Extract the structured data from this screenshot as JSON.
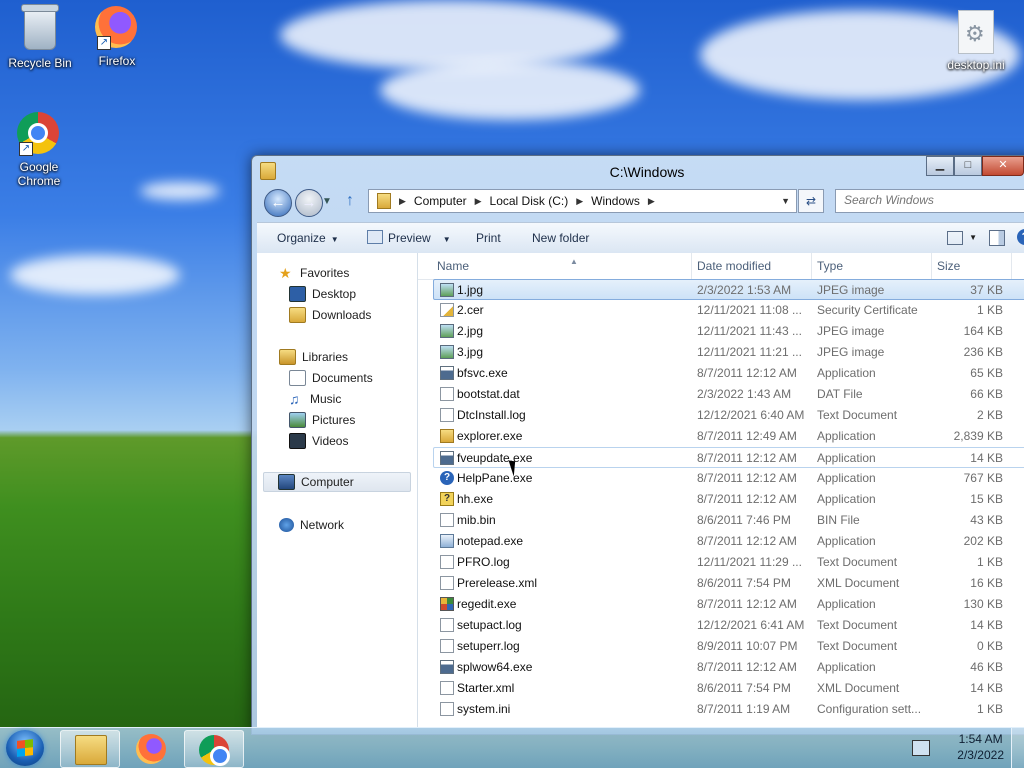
{
  "desktop": {
    "icons": [
      {
        "label": "Recycle Bin"
      },
      {
        "label": "Firefox"
      },
      {
        "label": "Google Chrome"
      },
      {
        "label": "desktop.ini"
      }
    ]
  },
  "window": {
    "title": "C:\\Windows",
    "address": {
      "crumbs": [
        "Computer",
        "Local Disk (C:)",
        "Windows"
      ]
    },
    "search": {
      "placeholder": "Search Windows"
    },
    "toolbar": {
      "organize": "Organize",
      "preview": "Preview",
      "print": "Print",
      "new_folder": "New folder"
    },
    "nav": {
      "favorites": "Favorites",
      "desktop": "Desktop",
      "downloads": "Downloads",
      "libraries": "Libraries",
      "documents": "Documents",
      "music": "Music",
      "pictures": "Pictures",
      "videos": "Videos",
      "computer": "Computer",
      "network": "Network"
    },
    "columns": {
      "name": "Name",
      "date": "Date modified",
      "type": "Type",
      "size": "Size"
    },
    "files": [
      {
        "name": "1.jpg",
        "date": "2/3/2022 1:53 AM",
        "type": "JPEG image",
        "size": "37 KB",
        "icon": "image-icon"
      },
      {
        "name": "2.cer",
        "date": "12/11/2021 11:08 ...",
        "type": "Security Certificate",
        "size": "1 KB",
        "icon": "certificate-icon"
      },
      {
        "name": "2.jpg",
        "date": "12/11/2021 11:43 ...",
        "type": "JPEG image",
        "size": "164 KB",
        "icon": "image-icon"
      },
      {
        "name": "3.jpg",
        "date": "12/11/2021 11:21 ...",
        "type": "JPEG image",
        "size": "236 KB",
        "icon": "image-icon"
      },
      {
        "name": "bfsvc.exe",
        "date": "8/7/2011 12:12 AM",
        "type": "Application",
        "size": "65 KB",
        "icon": "application-icon"
      },
      {
        "name": "bootstat.dat",
        "date": "2/3/2022 1:43 AM",
        "type": "DAT File",
        "size": "66 KB",
        "icon": "document-icon"
      },
      {
        "name": "DtcInstall.log",
        "date": "12/12/2021 6:40 AM",
        "type": "Text Document",
        "size": "2 KB",
        "icon": "document-icon"
      },
      {
        "name": "explorer.exe",
        "date": "8/7/2011 12:49 AM",
        "type": "Application",
        "size": "2,839 KB",
        "icon": "folder-icon"
      },
      {
        "name": "fveupdate.exe",
        "date": "8/7/2011 12:12 AM",
        "type": "Application",
        "size": "14 KB",
        "icon": "application-icon"
      },
      {
        "name": "HelpPane.exe",
        "date": "8/7/2011 12:12 AM",
        "type": "Application",
        "size": "767 KB",
        "icon": "help-icon"
      },
      {
        "name": "hh.exe",
        "date": "8/7/2011 12:12 AM",
        "type": "Application",
        "size": "15 KB",
        "icon": "hh-icon"
      },
      {
        "name": "mib.bin",
        "date": "8/6/2011 7:46 PM",
        "type": "BIN File",
        "size": "43 KB",
        "icon": "document-icon"
      },
      {
        "name": "notepad.exe",
        "date": "8/7/2011 12:12 AM",
        "type": "Application",
        "size": "202 KB",
        "icon": "notepad-icon"
      },
      {
        "name": "PFRO.log",
        "date": "12/11/2021 11:29 ...",
        "type": "Text Document",
        "size": "1 KB",
        "icon": "document-icon"
      },
      {
        "name": "Prerelease.xml",
        "date": "8/6/2011 7:54 PM",
        "type": "XML Document",
        "size": "16 KB",
        "icon": "document-icon"
      },
      {
        "name": "regedit.exe",
        "date": "8/7/2011 12:12 AM",
        "type": "Application",
        "size": "130 KB",
        "icon": "regedit-icon"
      },
      {
        "name": "setupact.log",
        "date": "12/12/2021 6:41 AM",
        "type": "Text Document",
        "size": "14 KB",
        "icon": "document-icon"
      },
      {
        "name": "setuperr.log",
        "date": "8/9/2011 10:07 PM",
        "type": "Text Document",
        "size": "0 KB",
        "icon": "document-icon"
      },
      {
        "name": "splwow64.exe",
        "date": "8/7/2011 12:12 AM",
        "type": "Application",
        "size": "46 KB",
        "icon": "application-icon"
      },
      {
        "name": "Starter.xml",
        "date": "8/6/2011 7:54 PM",
        "type": "XML Document",
        "size": "14 KB",
        "icon": "document-icon"
      },
      {
        "name": "system.ini",
        "date": "8/7/2011 1:19 AM",
        "type": "Configuration sett...",
        "size": "1 KB",
        "icon": "document-icon"
      }
    ]
  },
  "taskbar": {
    "clock": {
      "time": "1:54 AM",
      "date": "2/3/2022"
    }
  }
}
